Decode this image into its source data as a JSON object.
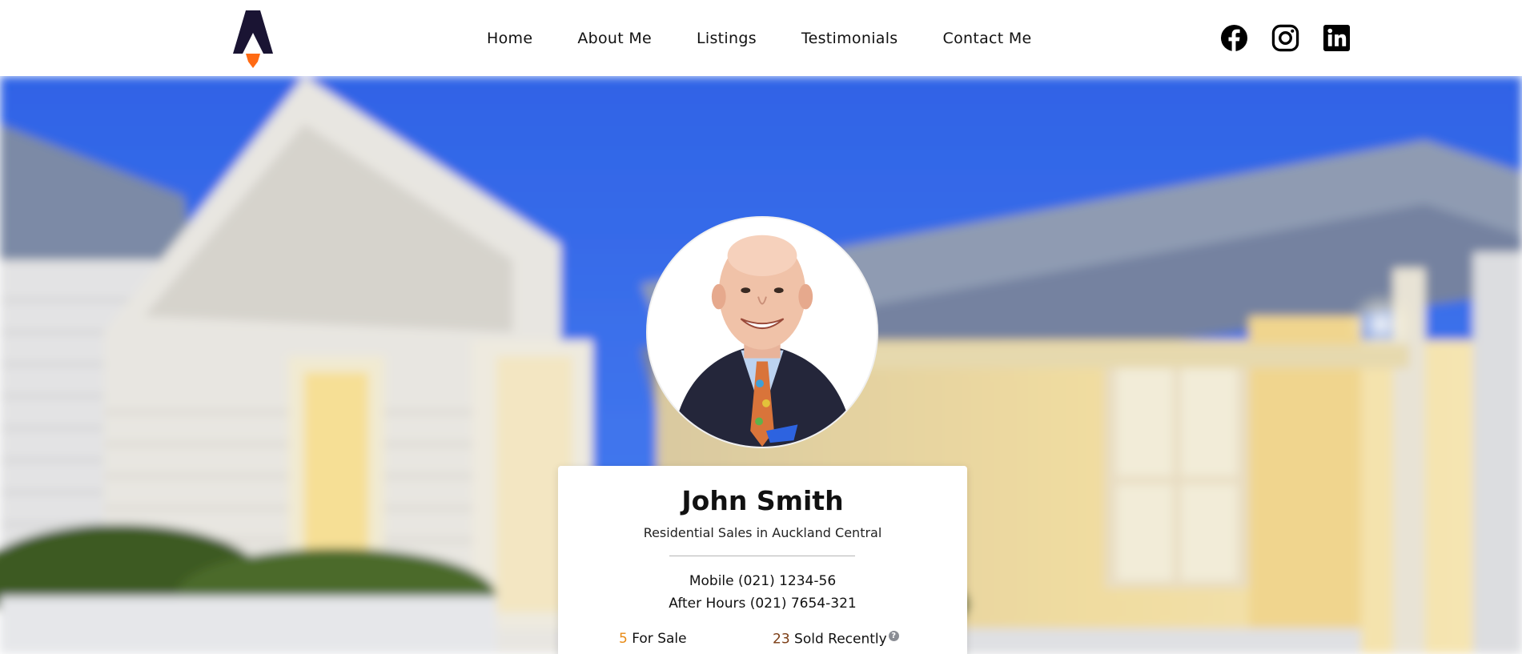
{
  "brand": {
    "logo_icon": "rocket-a-logo-icon",
    "colors": {
      "logo_dark": "#1a1433",
      "logo_flame": "#ff6a13"
    }
  },
  "nav": {
    "items": [
      {
        "label": "Home"
      },
      {
        "label": "About Me"
      },
      {
        "label": "Listings"
      },
      {
        "label": "Testimonials"
      },
      {
        "label": "Contact Me"
      }
    ]
  },
  "social": {
    "icons": [
      "facebook-icon",
      "instagram-icon",
      "linkedin-icon"
    ]
  },
  "hero": {
    "background": "blurred-villa-house-image",
    "colors": {
      "sky": "#3a6fe8",
      "house": "#e9e4d8"
    }
  },
  "agent": {
    "name": "John Smith",
    "role": "Residential Sales in Auckland Central",
    "mobile": "Mobile (021) 1234-56",
    "after_hours": "After Hours (021) 7654-321",
    "for_sale_count": "5",
    "for_sale_label": "For Sale",
    "sold_count": "23",
    "sold_label": "Sold Recently",
    "help_icon_text": "?",
    "colors": {
      "for_sale_count": "#e88a14",
      "sold_count": "#7a3b12"
    }
  }
}
